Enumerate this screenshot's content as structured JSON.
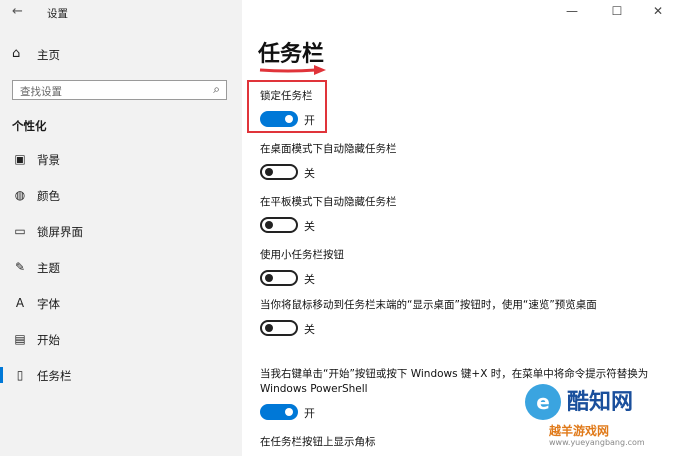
{
  "window": {
    "title": "设置",
    "back_icon": "back-arrow-icon",
    "controls": [
      "minimize-icon",
      "maximize-icon",
      "close-icon"
    ]
  },
  "sidebar": {
    "home_label": "主页",
    "search_placeholder": "查找设置",
    "section_title": "个性化",
    "items": [
      {
        "label": "背景",
        "icon": "picture-icon"
      },
      {
        "label": "颜色",
        "icon": "palette-icon"
      },
      {
        "label": "锁屏界面",
        "icon": "lock-screen-icon"
      },
      {
        "label": "主题",
        "icon": "theme-icon"
      },
      {
        "label": "字体",
        "icon": "font-icon"
      },
      {
        "label": "开始",
        "icon": "start-icon"
      },
      {
        "label": "任务栏",
        "icon": "taskbar-icon",
        "active": true
      }
    ]
  },
  "main": {
    "title": "任务栏",
    "settings": [
      {
        "label": "锁定任务栏",
        "state": "开",
        "on": true
      },
      {
        "label": "在桌面模式下自动隐藏任务栏",
        "state": "关",
        "on": false
      },
      {
        "label": "在平板模式下自动隐藏任务栏",
        "state": "关",
        "on": false
      },
      {
        "label": "使用小任务栏按钮",
        "state": "关",
        "on": false
      },
      {
        "label": "当你将鼠标移动到任务栏末端的“显示桌面”按钮时，使用“速览”预览桌面",
        "state": "关",
        "on": false
      },
      {
        "label": "当我右键单击“开始”按钮或按下 Windows 键+X 时，在菜单中将命令提示符替换为 Windows PowerShell",
        "state": "开",
        "on": true
      },
      {
        "label": "在任务栏按钮上显示角标"
      }
    ]
  },
  "watermark": {
    "brand": "酷知网",
    "sub": "越羊游戏网",
    "url": "www.yueyangbang.com"
  },
  "colors": {
    "accent": "#0078d7",
    "highlight": "#e0343a",
    "sidebar_bg": "#f2f2f2"
  }
}
